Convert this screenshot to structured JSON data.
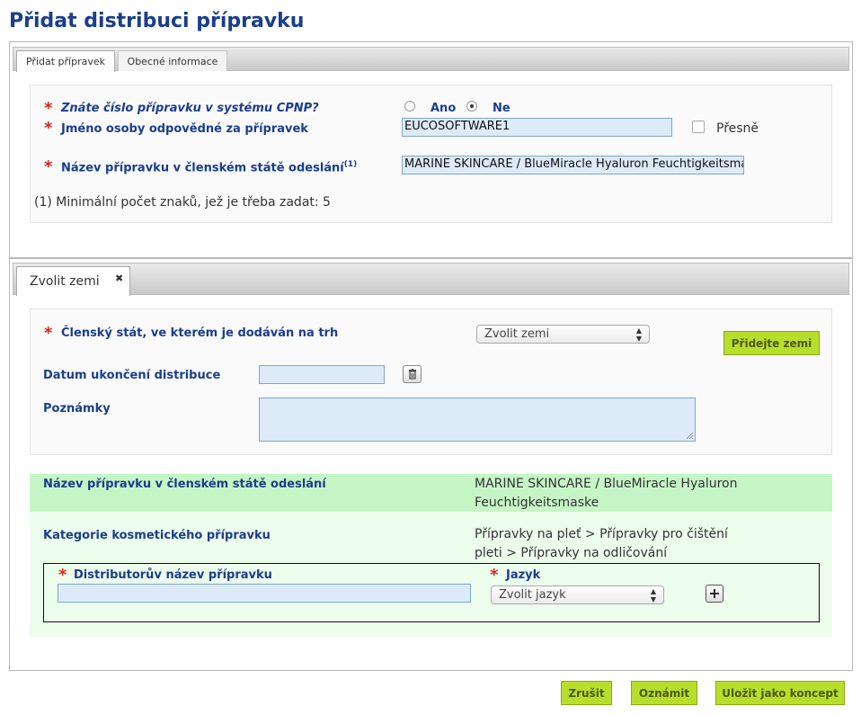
{
  "page": {
    "title": "Přidat distribuci přípravku"
  },
  "tabs": [
    {
      "label": "Přidat přípravek"
    },
    {
      "label": "Obecné informace"
    }
  ],
  "cpnp": {
    "question": "Znáte číslo přípravku v systému CPNP?",
    "yes_label": "Ano",
    "no_label": "Ne",
    "selected": "Ne"
  },
  "person": {
    "label": "Jméno osoby odpovědné za přípravek",
    "value": "EUCOSOFTWARE1",
    "exact_label": "Přesně"
  },
  "product_name": {
    "label": "Název přípravku v členském státě odeslání",
    "sup": "(1)",
    "value": "MARINE SKINCARE / BlueMiracle Hyaluron Feuchtigkeitsmaske"
  },
  "footnote": "(1) Minimální počet znaků, jež je třeba zadat: 5",
  "country_tab": {
    "label": "Zvolit zemi",
    "close": "✖"
  },
  "country": {
    "member_state_label": "Členský stát, ve kterém je dodáván na trh",
    "select_value": "Zvolit zemi",
    "add_button": "Přidejte zemi",
    "end_date_label": "Datum ukončení distribuce",
    "end_date_value": "",
    "notes_label": "Poznámky",
    "notes_value": ""
  },
  "info": {
    "name_label": "Název přípravku v členském státě odeslání",
    "name_line1": "MARINE SKINCARE / BlueMiracle Hyaluron",
    "name_line2": "Feuchtigkeitsmaske",
    "category_label": "Kategorie kosmetického přípravku",
    "category_line1": "Přípravky na pleť > Přípravky pro čištění",
    "category_line2": "pleti > Přípravky na odličování"
  },
  "distributor": {
    "name_label": "Distributorův název přípravku",
    "name_value": "",
    "language_label": "Jazyk",
    "language_select": "Zvolit jazyk",
    "add_symbol": "+"
  },
  "footer": {
    "cancel": "Zrušit",
    "notify": "Oznámit",
    "save_draft": "Uložit jako koncept"
  }
}
